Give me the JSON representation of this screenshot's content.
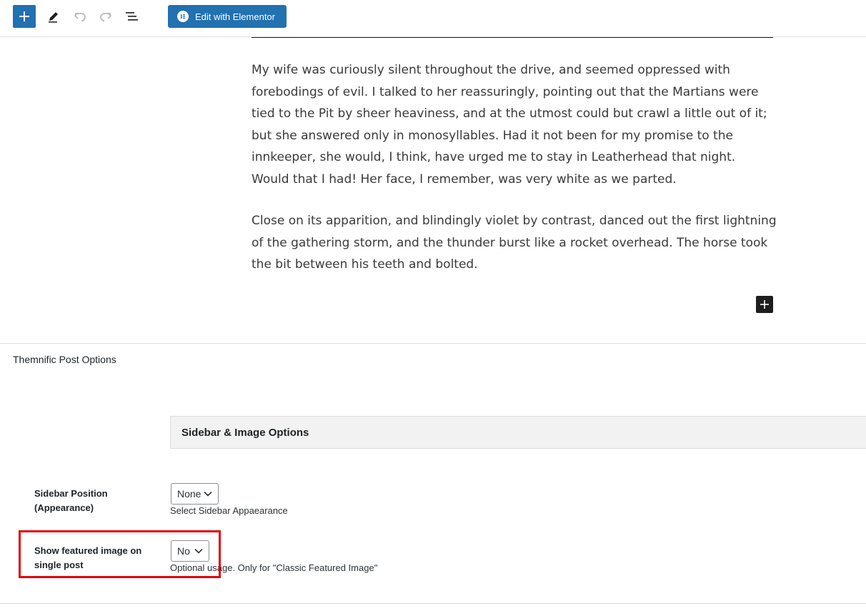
{
  "toolbar": {
    "add_block_icon": "plus-icon",
    "tools_icon": "pencil-icon",
    "undo_icon": "undo-icon",
    "redo_icon": "redo-icon",
    "document_overview_icon": "list-view-icon",
    "elementor_button_label": "Edit with Elementor",
    "elementor_icon": "elementor-logo-icon"
  },
  "content": {
    "paragraphs": [
      "My wife was curiously silent throughout the drive, and seemed oppressed with forebodings of evil. I talked to her reassuringly, pointing out that the Martians were tied to the Pit by sheer heaviness, and at the utmost could but crawl a little out of it; but she answered only in monosyllables. Had it not been for my promise to the innkeeper, she would, I think, have urged me to stay in Leatherhead that night. Would that I had! Her face, I remember, was very white as we parted.",
      "Close on its apparition, and blindingly violet by contrast, danced out the first lightning of the gathering storm, and the thunder burst like a rocket overhead. The horse took the bit between his teeth and bolted."
    ],
    "block_inserter_icon": "plus-icon"
  },
  "meta_box": {
    "title": "Themnific Post Options",
    "section_title": "Sidebar & Image Options",
    "options": [
      {
        "label": "Sidebar Position (Appearance)",
        "selected": "None",
        "help": "Select Sidebar Appaearance"
      },
      {
        "label": "Show featured image on single post",
        "selected": "No",
        "help": "Optional usage. Only for \"Classic Featured Image\""
      }
    ],
    "highlight_color": "#e0070b"
  },
  "colors": {
    "accent": "#2271b1",
    "text": "#3a3a3a"
  }
}
